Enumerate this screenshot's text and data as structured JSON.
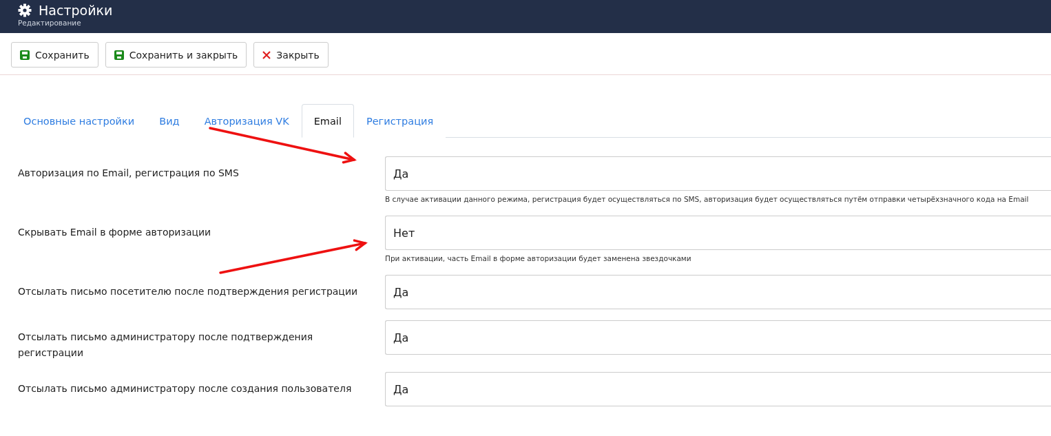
{
  "header": {
    "title": "Настройки",
    "subtitle": "Редактирование"
  },
  "toolbar": [
    {
      "kind": "save",
      "label": "Сохранить"
    },
    {
      "kind": "save",
      "label": "Сохранить и закрыть"
    },
    {
      "kind": "close",
      "label": "Закрыть"
    }
  ],
  "tabs": [
    {
      "label": "Основные настройки",
      "selected": false
    },
    {
      "label": "Вид",
      "selected": false
    },
    {
      "label": "Авторизация VK",
      "selected": false
    },
    {
      "label": "Email",
      "selected": true
    },
    {
      "label": "Регистрация",
      "selected": false
    }
  ],
  "fields": [
    {
      "label": "Авторизация по Email, регистрация по SMS",
      "value": "Да",
      "help": "В случае активации данного режима, регистрация будет осуществляться по SMS, авторизация будет осуществляться путём отправки четырёхзначного кода на Email"
    },
    {
      "label": "Скрывать Email в форме авторизации",
      "value": "Нет",
      "help": "При активации, часть Email в форме авторизации будет заменена звездочками"
    },
    {
      "label": "Отсылать письмо посетителю после подтверждения регистрации",
      "value": "Да"
    },
    {
      "label": "Отсылать письмо администратору после подтверждения регистрации",
      "value": "Да"
    },
    {
      "label": "Отсылать письмо администратору после создания пользователя",
      "value": "Да"
    }
  ]
}
